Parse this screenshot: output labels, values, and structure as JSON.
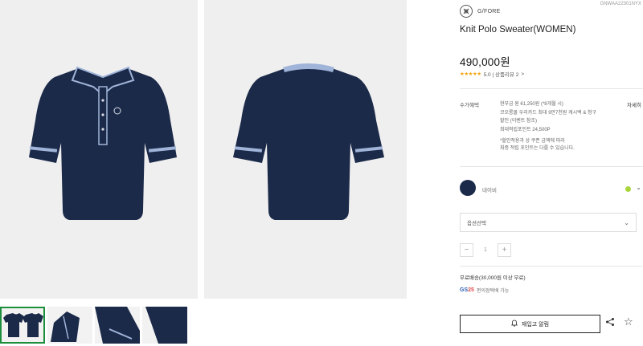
{
  "brand": {
    "name": "G/FORE",
    "sku": "GNWAA22301NYX",
    "logo": "gfore-logo-icon"
  },
  "product": {
    "title": "Knit Polo Sweater(WOMEN)",
    "price": "490,000원",
    "rating_stars": "★★★★★",
    "rating_text": "5.0 | 상품리뷰 2",
    "rating_arrow": ">"
  },
  "benefit": {
    "label": "수가혜택",
    "detail_link": "자세히",
    "lines": [
      "현부금 원 61,250원 (*8개월 시)",
      "코오롱몰 우리카드 최대 9만7천원 캐시백 & 청구",
      "할인 (이벤트 참조)",
      "최대적립포인트 24,500P"
    ],
    "note_1": "*할인적용과 상 쿠폰 금액에 따라",
    "note_2": "최종 적립 포인트는 다를 수 있습니다."
  },
  "color": {
    "name": "네이비",
    "hex": "#1c2a4a",
    "stock_color": "#a8d63a"
  },
  "option": {
    "placeholder": "옵션선택"
  },
  "quantity": {
    "minus": "−",
    "value": "1",
    "plus": "+"
  },
  "shipping": {
    "text": "무료배송(30,000원 이상 무료)",
    "gs_logo": "GS",
    "gs_logo_num": "25",
    "gs_text": "편의점택배 가능"
  },
  "actions": {
    "restock_label": "재입고 알림",
    "restock_icon": "bell-icon",
    "share_icon": "share-icon",
    "fav_icon": "star-icon"
  },
  "images": {
    "main": [
      "front-view",
      "back-view"
    ],
    "thumbnails": [
      "front-back-pair",
      "detail-angle",
      "sleeve-detail",
      "fabric-detail"
    ]
  },
  "colors": {
    "navy": "#1c2a4a",
    "trim": "#9fb4d8",
    "bg": "#efefef",
    "accent": "#1d8f3c"
  }
}
